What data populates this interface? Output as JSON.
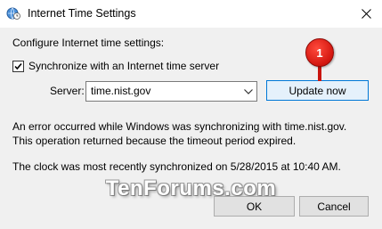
{
  "window": {
    "title": "Internet Time Settings",
    "title_icon": "globe-clock-icon",
    "close_icon": "close-icon"
  },
  "main": {
    "heading": "Configure Internet time settings:",
    "sync_checkbox": {
      "label": "Synchronize with an Internet time server",
      "checked": true
    },
    "server": {
      "label": "Server:",
      "value": "time.nist.gov"
    },
    "update_button": "Update now",
    "error_lines": [
      "An error occurred while Windows was synchronizing with time.nist.gov.",
      "This operation returned because the timeout period expired."
    ],
    "sync_status": "The clock was most recently synchronized on 5/28/2015 at 10:40 AM."
  },
  "annotation": {
    "badge": "1",
    "color": "#e0190f"
  },
  "watermark": "TenForums.com",
  "footer": {
    "ok": "OK",
    "cancel": "Cancel"
  },
  "colors": {
    "accent": "#0078d7",
    "dialog_bg": "#f0f0f0",
    "button_bg": "#e1e1e1"
  }
}
